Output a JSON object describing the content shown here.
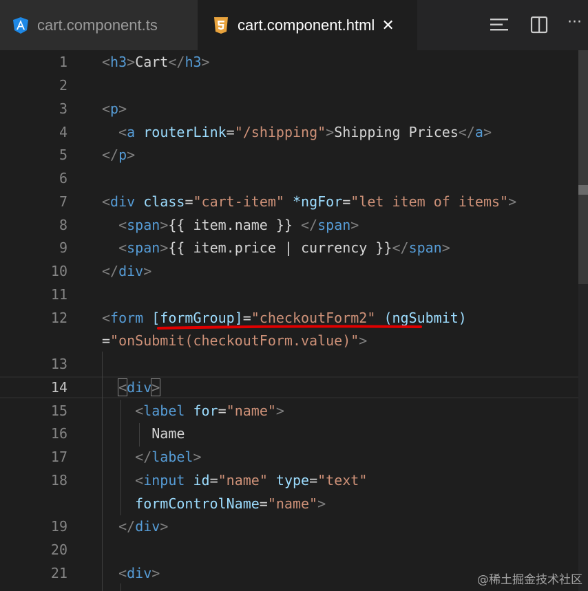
{
  "tabs": [
    {
      "label": "cart.component.ts",
      "icon": "angular-icon",
      "active": false
    },
    {
      "label": "cart.component.html",
      "icon": "html5-icon",
      "active": true,
      "close": "✕"
    }
  ],
  "toolbar": {
    "more": "···"
  },
  "watermark": "@稀土掘金技术社区",
  "colors": {
    "background": "#1e1e1e",
    "tag": "#569cd6",
    "attribute": "#9cdcfe",
    "string": "#ce9178",
    "bracket": "#808080",
    "text": "#d4d4d4",
    "underline": "#e00000"
  },
  "lines": [
    {
      "num": "1",
      "tokens": [
        {
          "c": "bk",
          "t": "<"
        },
        {
          "c": "tag",
          "t": "h3"
        },
        {
          "c": "bk",
          "t": ">"
        },
        {
          "c": "tx",
          "t": "Cart"
        },
        {
          "c": "bk",
          "t": "</"
        },
        {
          "c": "tag",
          "t": "h3"
        },
        {
          "c": "bk",
          "t": ">"
        }
      ]
    },
    {
      "num": "2",
      "tokens": []
    },
    {
      "num": "3",
      "tokens": [
        {
          "c": "bk",
          "t": "<"
        },
        {
          "c": "tag",
          "t": "p"
        },
        {
          "c": "bk",
          "t": ">"
        }
      ]
    },
    {
      "num": "4",
      "tokens": [
        {
          "c": "tx",
          "t": "  "
        },
        {
          "c": "bk",
          "t": "<"
        },
        {
          "c": "tag",
          "t": "a"
        },
        {
          "c": "tx",
          "t": " "
        },
        {
          "c": "at",
          "t": "routerLink"
        },
        {
          "c": "tx",
          "t": "="
        },
        {
          "c": "str",
          "t": "\"/shipping\""
        },
        {
          "c": "bk",
          "t": ">"
        },
        {
          "c": "tx",
          "t": "Shipping Prices"
        },
        {
          "c": "bk",
          "t": "</"
        },
        {
          "c": "tag",
          "t": "a"
        },
        {
          "c": "bk",
          "t": ">"
        }
      ]
    },
    {
      "num": "5",
      "tokens": [
        {
          "c": "bk",
          "t": "</"
        },
        {
          "c": "tag",
          "t": "p"
        },
        {
          "c": "bk",
          "t": ">"
        }
      ]
    },
    {
      "num": "6",
      "tokens": []
    },
    {
      "num": "7",
      "tokens": [
        {
          "c": "bk",
          "t": "<"
        },
        {
          "c": "tag",
          "t": "div"
        },
        {
          "c": "tx",
          "t": " "
        },
        {
          "c": "at",
          "t": "class"
        },
        {
          "c": "tx",
          "t": "="
        },
        {
          "c": "str",
          "t": "\"cart-item\""
        },
        {
          "c": "tx",
          "t": " "
        },
        {
          "c": "at",
          "t": "*ngFor"
        },
        {
          "c": "tx",
          "t": "="
        },
        {
          "c": "str",
          "t": "\"let item of items\""
        },
        {
          "c": "bk",
          "t": ">"
        }
      ]
    },
    {
      "num": "8",
      "tokens": [
        {
          "c": "tx",
          "t": "  "
        },
        {
          "c": "bk",
          "t": "<"
        },
        {
          "c": "tag",
          "t": "span"
        },
        {
          "c": "bk",
          "t": ">"
        },
        {
          "c": "tx",
          "t": "{{ item.name }} "
        },
        {
          "c": "bk",
          "t": "</"
        },
        {
          "c": "tag",
          "t": "span"
        },
        {
          "c": "bk",
          "t": ">"
        }
      ]
    },
    {
      "num": "9",
      "tokens": [
        {
          "c": "tx",
          "t": "  "
        },
        {
          "c": "bk",
          "t": "<"
        },
        {
          "c": "tag",
          "t": "span"
        },
        {
          "c": "bk",
          "t": ">"
        },
        {
          "c": "tx",
          "t": "{{ item.price | currency }}"
        },
        {
          "c": "bk",
          "t": "</"
        },
        {
          "c": "tag",
          "t": "span"
        },
        {
          "c": "bk",
          "t": ">"
        }
      ]
    },
    {
      "num": "10",
      "tokens": [
        {
          "c": "bk",
          "t": "</"
        },
        {
          "c": "tag",
          "t": "div"
        },
        {
          "c": "bk",
          "t": ">"
        }
      ]
    },
    {
      "num": "11",
      "tokens": []
    },
    {
      "num": "12",
      "tokens": [
        {
          "c": "bk",
          "t": "<"
        },
        {
          "c": "tag",
          "t": "form"
        },
        {
          "c": "tx",
          "t": " "
        },
        {
          "c": "at",
          "t": "[formGroup]"
        },
        {
          "c": "tx",
          "t": "="
        },
        {
          "c": "str",
          "t": "\"checkoutForm2\""
        },
        {
          "c": "tx",
          "t": " "
        },
        {
          "c": "at",
          "t": "(ngSubmit)"
        }
      ]
    },
    {
      "num": "",
      "tokens": [
        {
          "c": "tx",
          "t": "="
        },
        {
          "c": "str",
          "t": "\"onSubmit(checkoutForm.value)\""
        },
        {
          "c": "bk",
          "t": ">"
        }
      ]
    },
    {
      "num": "13",
      "tokens": []
    },
    {
      "num": "14",
      "active": true,
      "tokens": [
        {
          "c": "tx",
          "t": "  "
        },
        {
          "c": "bk",
          "t": "<",
          "box": true
        },
        {
          "c": "tag",
          "t": "div"
        },
        {
          "c": "bk",
          "t": ">",
          "box": true
        }
      ]
    },
    {
      "num": "15",
      "tokens": [
        {
          "c": "tx",
          "t": "    "
        },
        {
          "c": "bk",
          "t": "<"
        },
        {
          "c": "tag",
          "t": "label"
        },
        {
          "c": "tx",
          "t": " "
        },
        {
          "c": "at",
          "t": "for"
        },
        {
          "c": "tx",
          "t": "="
        },
        {
          "c": "str",
          "t": "\"name\""
        },
        {
          "c": "bk",
          "t": ">"
        }
      ]
    },
    {
      "num": "16",
      "tokens": [
        {
          "c": "tx",
          "t": "      Name"
        }
      ]
    },
    {
      "num": "17",
      "tokens": [
        {
          "c": "tx",
          "t": "    "
        },
        {
          "c": "bk",
          "t": "</"
        },
        {
          "c": "tag",
          "t": "label"
        },
        {
          "c": "bk",
          "t": ">"
        }
      ]
    },
    {
      "num": "18",
      "tokens": [
        {
          "c": "tx",
          "t": "    "
        },
        {
          "c": "bk",
          "t": "<"
        },
        {
          "c": "tag",
          "t": "input"
        },
        {
          "c": "tx",
          "t": " "
        },
        {
          "c": "at",
          "t": "id"
        },
        {
          "c": "tx",
          "t": "="
        },
        {
          "c": "str",
          "t": "\"name\""
        },
        {
          "c": "tx",
          "t": " "
        },
        {
          "c": "at",
          "t": "type"
        },
        {
          "c": "tx",
          "t": "="
        },
        {
          "c": "str",
          "t": "\"text\""
        }
      ]
    },
    {
      "num": "",
      "tokens": [
        {
          "c": "tx",
          "t": "    "
        },
        {
          "c": "at",
          "t": "formControlName"
        },
        {
          "c": "tx",
          "t": "="
        },
        {
          "c": "str",
          "t": "\"name\""
        },
        {
          "c": "bk",
          "t": ">"
        }
      ]
    },
    {
      "num": "19",
      "tokens": [
        {
          "c": "tx",
          "t": "  "
        },
        {
          "c": "bk",
          "t": "</"
        },
        {
          "c": "tag",
          "t": "div"
        },
        {
          "c": "bk",
          "t": ">"
        }
      ]
    },
    {
      "num": "20",
      "tokens": []
    },
    {
      "num": "21",
      "tokens": [
        {
          "c": "tx",
          "t": "  "
        },
        {
          "c": "bk",
          "t": "<"
        },
        {
          "c": "tag",
          "t": "div"
        },
        {
          "c": "bk",
          "t": ">"
        }
      ]
    }
  ]
}
